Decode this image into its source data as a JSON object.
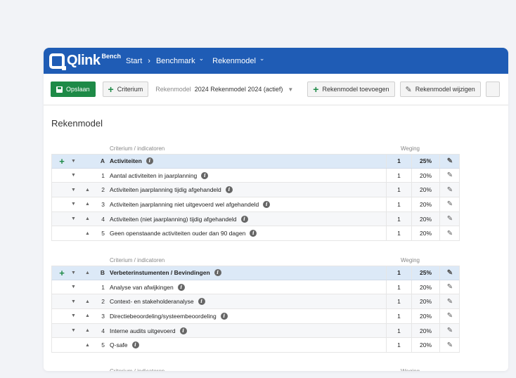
{
  "nav": {
    "logo": "Qlink",
    "logo_sub": "Bench",
    "breadcrumbs": [
      "Start",
      "Benchmark",
      "Rekenmodel"
    ],
    "sep": "›",
    "chev": "⌄"
  },
  "toolbar": {
    "save_label": "Opslaan",
    "criterium_label": "Criterium",
    "model_label": "Rekenmodel",
    "model_value": "2024 Rekenmodel 2024 (actief)",
    "add_model_label": "Rekenmodel toevoegen",
    "edit_model_label": "Rekenmodel wijzigen"
  },
  "page_title": "Rekenmodel",
  "table_headers": {
    "criterion": "Criterium / indicatoren",
    "weight": "Weging"
  },
  "groups": [
    {
      "letter": "A",
      "name": "Activiteiten",
      "weight": "1",
      "percent": "25%",
      "items": [
        {
          "num": "1",
          "name": "Aantal activiteiten in jaarplanning",
          "weight": "1",
          "percent": "20%"
        },
        {
          "num": "2",
          "name": "Activiteiten jaarplanning tijdig afgehandeld",
          "weight": "1",
          "percent": "20%"
        },
        {
          "num": "3",
          "name": "Activiteiten jaarplanning niet uitgevoerd wel afgehandeld",
          "weight": "1",
          "percent": "20%"
        },
        {
          "num": "4",
          "name": "Activiteiten (niet jaarplanning) tijdig afgehandeld",
          "weight": "1",
          "percent": "20%"
        },
        {
          "num": "5",
          "name": "Geen openstaande activiteiten ouder dan 90 dagen",
          "weight": "1",
          "percent": "20%"
        }
      ]
    },
    {
      "letter": "B",
      "name": "Verbeterinstumenten / Bevindingen",
      "weight": "1",
      "percent": "25%",
      "items": [
        {
          "num": "1",
          "name": "Analyse van afwijkingen",
          "weight": "1",
          "percent": "20%"
        },
        {
          "num": "2",
          "name": "Context- en stakeholderanalyse",
          "weight": "1",
          "percent": "20%"
        },
        {
          "num": "3",
          "name": "Directiebeoordeling/systeembeoordeling",
          "weight": "1",
          "percent": "20%"
        },
        {
          "num": "4",
          "name": "Interne audits uitgevoerd",
          "weight": "1",
          "percent": "20%"
        },
        {
          "num": "5",
          "name": "Q-safe",
          "weight": "1",
          "percent": "20%"
        }
      ]
    }
  ],
  "glyphs": {
    "plus": "+",
    "down": "▼",
    "up": "▲",
    "info": "i",
    "pencil": "✎"
  }
}
